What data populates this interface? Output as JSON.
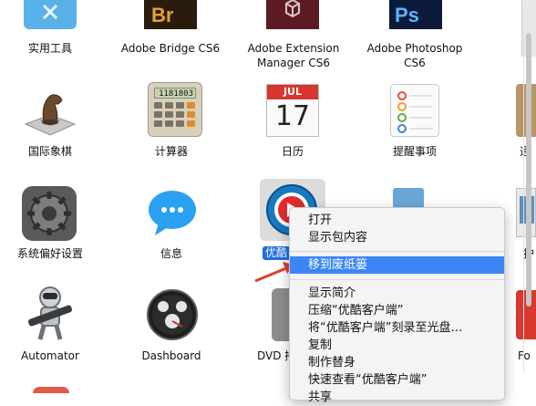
{
  "apps_row1": [
    {
      "label": "实用工具"
    },
    {
      "label": "Adobe Bridge CS6",
      "badge": "Br"
    },
    {
      "label": "Adobe Extension Manager CS6"
    },
    {
      "label": "Adobe Photoshop CS6",
      "badge": "Ps"
    }
  ],
  "apps_row2": [
    {
      "label": "国际象棋"
    },
    {
      "label": "计算器",
      "display": "1181803"
    },
    {
      "label": "日历",
      "month": "JUL",
      "day": "17"
    },
    {
      "label": "提醒事项"
    },
    {
      "label": "通"
    }
  ],
  "apps_row3": [
    {
      "label": "系统偏好设置"
    },
    {
      "label": "信息"
    },
    {
      "label": "优酷"
    },
    {
      "label": "护"
    }
  ],
  "apps_row4": [
    {
      "label": "Automator"
    },
    {
      "label": "Dashboard"
    },
    {
      "label": "DVD 播"
    },
    {
      "label": "Fo"
    }
  ],
  "context_menu": {
    "items": [
      "打开",
      "显示包内容",
      "移到废纸篓",
      "显示简介",
      "压缩“优酷客户端”",
      "将“优酷客户端”刻录至光盘…",
      "复制",
      "制作替身",
      "快速查看“优酷客户端”",
      "共享"
    ],
    "selected_index": 2
  },
  "colors": {
    "selection": "#3a86f5",
    "arrow": "#e0402c",
    "bridge_bg": "#2a1c0c",
    "bridge_text": "#e0a13a",
    "ps_bg": "#0b1a3a",
    "ps_text": "#5fb3ff"
  }
}
